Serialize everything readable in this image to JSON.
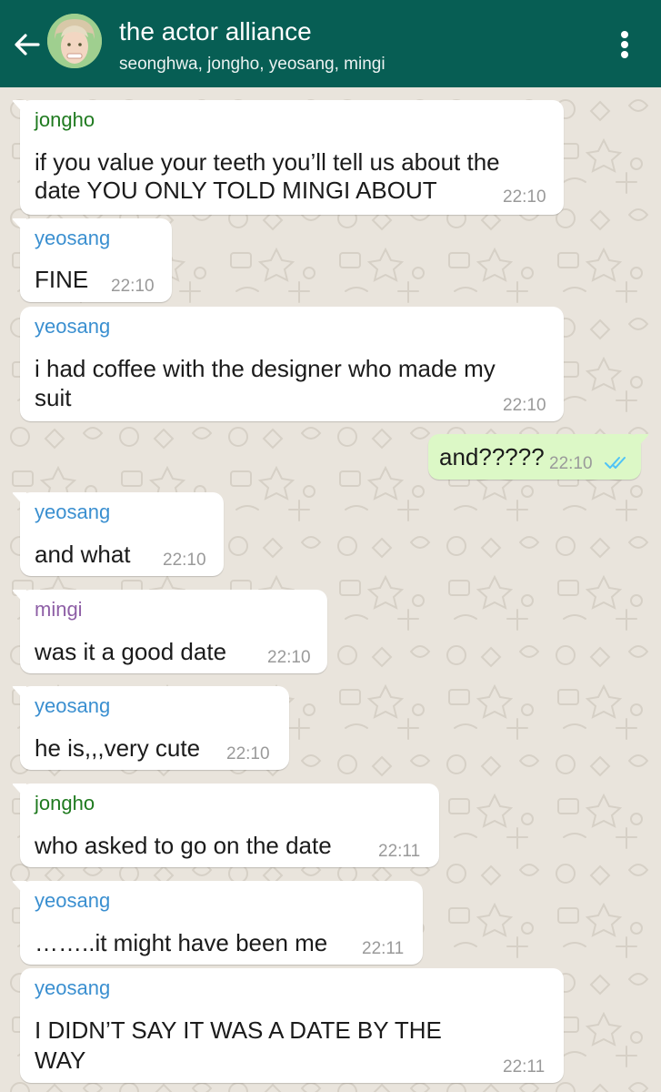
{
  "chat": {
    "title": "the actor alliance",
    "members": "seonghwa, jongho, yeosang, mingi"
  },
  "colors": {
    "header": "#075e54",
    "incoming_bubble": "#ffffff",
    "outgoing_bubble": "#dcf8c6",
    "jongho": "#1f7a1f",
    "yeosang": "#3a8fd0",
    "mingi": "#8e5fa6",
    "read_ticks": "#4fc3f7"
  },
  "messages": [
    {
      "sender": "jongho",
      "lines": [
        "if you value your teeth you’ll tell us about the",
        "date YOU ONLY TOLD MINGI ABOUT"
      ],
      "time": "22:10"
    },
    {
      "sender": "yeosang",
      "lines": [
        "FINE"
      ],
      "time": "22:10"
    },
    {
      "sender": "yeosang",
      "lines": [
        "i had coffee with the designer who made my",
        "suit"
      ],
      "time": "22:10"
    },
    {
      "sender": "",
      "lines": [
        "and?????"
      ],
      "time": "22:10",
      "outgoing": true
    },
    {
      "sender": "yeosang",
      "lines": [
        "and what"
      ],
      "time": "22:10"
    },
    {
      "sender": "mingi",
      "lines": [
        "was it a good date"
      ],
      "time": "22:10"
    },
    {
      "sender": "yeosang",
      "lines": [
        "he is,,,very cute"
      ],
      "time": "22:10"
    },
    {
      "sender": "jongho",
      "lines": [
        "who asked to go on the date"
      ],
      "time": "22:11"
    },
    {
      "sender": "yeosang",
      "lines": [
        "……..it might have been me"
      ],
      "time": "22:11"
    },
    {
      "sender": "yeosang",
      "lines": [
        "I DIDN’T SAY IT WAS A DATE BY THE",
        "WAY"
      ],
      "time": "22:11"
    }
  ]
}
